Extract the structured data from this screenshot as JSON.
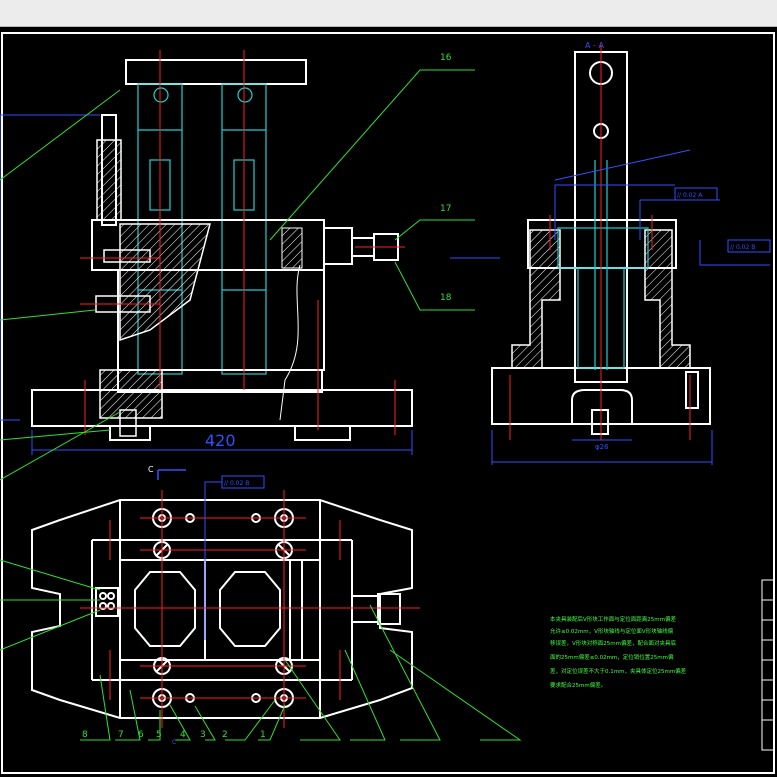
{
  "drawing": {
    "view_label_side": "A - A",
    "view_label_top": "C",
    "view_label_top_sub": "C",
    "dimension_main": "420",
    "dimension_side": "φ26",
    "balloons_right": [
      "16",
      "17",
      "18"
    ],
    "balloons_bottom": [
      "8",
      "7",
      "6",
      "5",
      "4",
      "3",
      "2",
      "1"
    ],
    "tolerance_frames": [
      "// 0.02 B",
      "// 0.02 A",
      "// 0.02 B",
      "// 0.02 B"
    ],
    "tech_requirements": [
      "本夹具装配后V形块工作面与定位面距离25mm偏差",
      "允许≤0.02mm，V形块轴线与定位面V形块轴线偏",
      "移误差，V形块对称面25mm偏差，配合面对夹具底",
      "面的25mm偏差≤0.02mm，定位销位置25mm偏",
      "差，对定位误差不大于0.1mm，夹具体定位25mm偏差",
      "要求配合25mm偏差。"
    ],
    "colors": {
      "outline": "#ffffff",
      "center": "#ff2020",
      "hidden": "#20d0d0",
      "dimension": "#3050ff",
      "leader": "#30e030",
      "hatch": "#ffffff",
      "note": "#40ff40"
    }
  }
}
